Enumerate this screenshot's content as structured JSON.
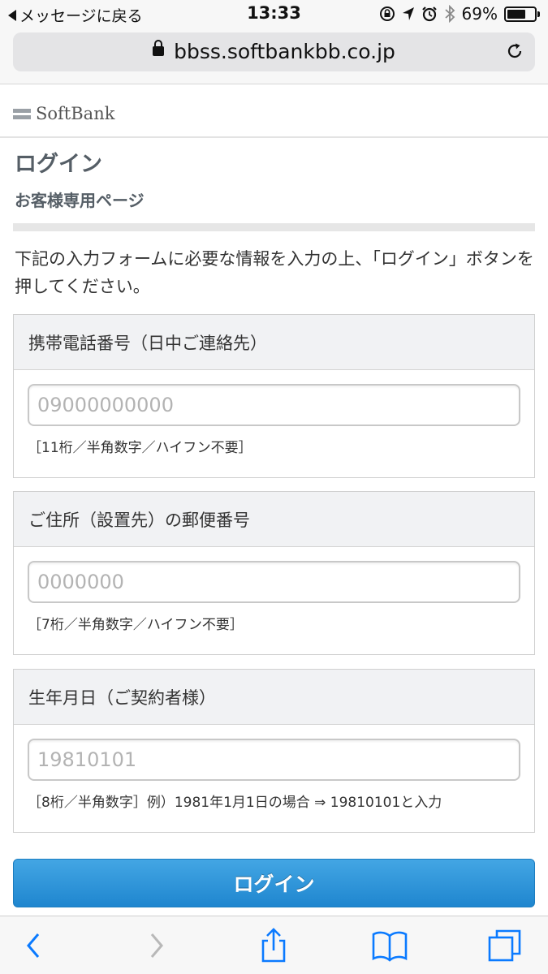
{
  "status_bar": {
    "back_label": "メッセージに戻る",
    "time": "13:33",
    "battery": "69%",
    "battery_level": 0.69
  },
  "browser": {
    "url": "bbss.softbankbb.co.jp"
  },
  "header": {
    "logo_text": "SoftBank"
  },
  "page": {
    "title": "ログイン",
    "subtitle": "お客様専用ページ",
    "intro": "下記の入力フォームに必要な情報を入力の上、「ログイン」ボタンを押してください。"
  },
  "form": {
    "phone": {
      "label": "携帯電話番号（日中ご連絡先）",
      "placeholder": "09000000000",
      "hint": "［11桁／半角数字／ハイフン不要］"
    },
    "zip": {
      "label": "ご住所（設置先）の郵便番号",
      "placeholder": "0000000",
      "hint": "［7桁／半角数字／ハイフン不要］"
    },
    "birthdate": {
      "label": "生年月日（ご契約者様）",
      "placeholder": "19810101",
      "hint": "［8桁／半角数字］例）1981年1月1日の場合 ⇒ 19810101と入力"
    },
    "submit_label": "ログイン"
  },
  "colors": {
    "accent": "#1f86cf",
    "ios_blue": "#0a7aff",
    "disabled": "#b8b8b8"
  }
}
